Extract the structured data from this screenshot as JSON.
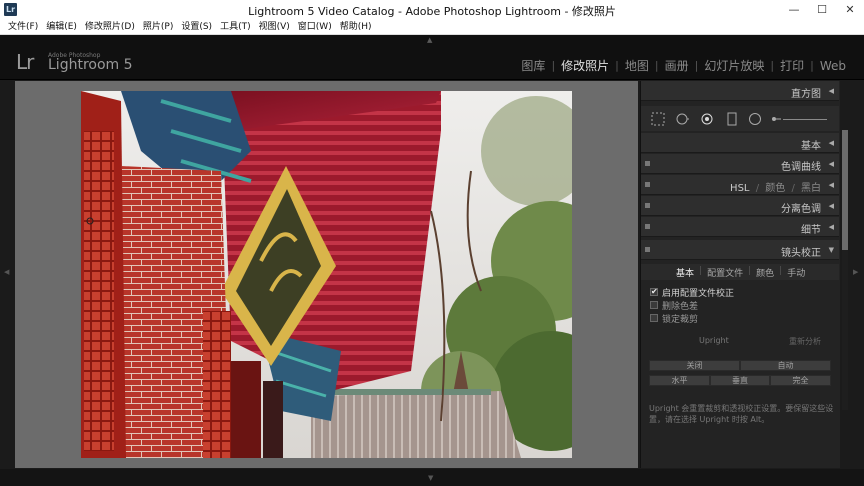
{
  "window": {
    "app_icon": "Lr",
    "title": "Lightroom 5 Video Catalog - Adobe Photoshop Lightroom - 修改照片",
    "minimize": "—",
    "maximize": "☐",
    "close": "✕"
  },
  "menu": [
    "文件(F)",
    "编辑(E)",
    "修改照片(D)",
    "照片(P)",
    "设置(S)",
    "工具(T)",
    "视图(V)",
    "窗口(W)",
    "帮助(H)"
  ],
  "identity": {
    "lr": "Lr",
    "adobe": "Adobe Photoshop",
    "product": "Lightroom 5"
  },
  "modules": [
    {
      "label": "图库",
      "active": false
    },
    {
      "label": "修改照片",
      "active": true
    },
    {
      "label": "地图",
      "active": false
    },
    {
      "label": "画册",
      "active": false
    },
    {
      "label": "幻灯片放映",
      "active": false
    },
    {
      "label": "打印",
      "active": false
    },
    {
      "label": "Web",
      "active": false
    }
  ],
  "panels": {
    "histogram": "直方图",
    "basic": "基本",
    "tone_curve": "色调曲线",
    "hsl": "HSL",
    "hsl_sep1": "/",
    "color": "颜色",
    "hsl_sep2": "/",
    "bw": "黑白",
    "split_toning": "分离色调",
    "detail": "细节",
    "lens_correction": "镜头校正"
  },
  "lens_tabs": [
    {
      "label": "基本",
      "active": true
    },
    {
      "label": "配置文件",
      "active": false
    },
    {
      "label": "颜色",
      "active": false
    },
    {
      "label": "手动",
      "active": false
    }
  ],
  "lens_options": [
    {
      "label": "启用配置文件校正",
      "checked": true,
      "mark": "✔"
    },
    {
      "label": "删除色差",
      "checked": false,
      "mark": ""
    },
    {
      "label": "锁定裁剪",
      "checked": false,
      "mark": ""
    }
  ],
  "upright": {
    "label": "Upright",
    "reanalyze": "重新分析",
    "off": "关闭",
    "auto": "自动",
    "level": "水平",
    "vertical": "垂直",
    "full": "完全",
    "note": "Upright 会重置裁剪和透视校正设置。要保留这些设置，请在选择 Upright 时按 Alt。"
  },
  "colors": {
    "panel_bg": "#232323",
    "center_bg": "#6c6c6c",
    "topbar_bg": "#101010",
    "active_text": "#e0e0e0"
  }
}
